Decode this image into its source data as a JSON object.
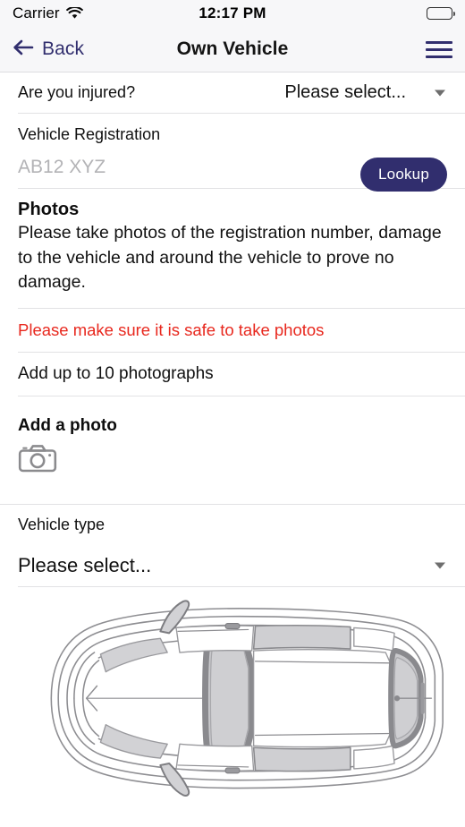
{
  "status_bar": {
    "carrier": "Carrier",
    "time": "12:17 PM",
    "wifi_icon": "wifi-icon",
    "battery_icon": "battery-full-icon"
  },
  "nav": {
    "back_label": "Back",
    "back_icon": "arrow-left-icon",
    "title": "Own Vehicle",
    "menu_icon": "hamburger-menu-icon"
  },
  "form": {
    "injured": {
      "label": "Are you injured?",
      "value": "Please select...",
      "caret_icon": "chevron-down-icon"
    },
    "registration": {
      "label": "Vehicle Registration",
      "placeholder": "AB12 XYZ",
      "value": "",
      "lookup_label": "Lookup"
    },
    "photos": {
      "heading": "Photos",
      "description": "Please take photos of the registration number, damage to the vehicle and around the vehicle to prove no damage.",
      "warning": "Please make sure it is safe to take photos",
      "limit_text": "Add up to 10 photographs",
      "add_photo_heading": "Add a photo",
      "camera_icon": "camera-icon"
    },
    "vehicle_type": {
      "label": "Vehicle type",
      "value": "Please select...",
      "caret_icon": "chevron-down-icon"
    }
  },
  "diagram": {
    "name": "car-top-view-diagram"
  },
  "colors": {
    "accent": "#312e6e",
    "warning": "#e8281e",
    "placeholder": "#b3b3b6",
    "divider": "#e2e2e4",
    "bar_background": "#f7f7f9"
  }
}
